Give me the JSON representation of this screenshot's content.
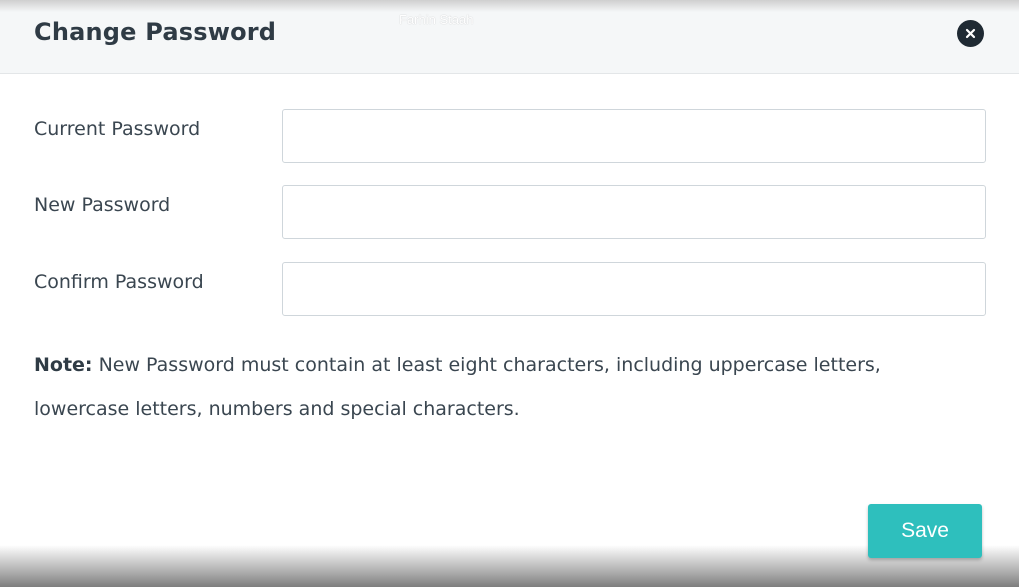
{
  "topbar": {
    "user_name": "Farhin Staah"
  },
  "modal": {
    "title": "Change Password",
    "close_icon": "close-icon",
    "fields": [
      {
        "label": "Current Password",
        "value": "",
        "placeholder": ""
      },
      {
        "label": "New Password",
        "value": "",
        "placeholder": ""
      },
      {
        "label": "Confirm Password",
        "value": "",
        "placeholder": ""
      }
    ],
    "note": {
      "prefix": "Note:",
      "text": " New Password must contain at least eight characters, including uppercase letters, lowercase letters, numbers and special characters."
    },
    "save_label": "Save"
  },
  "colors": {
    "accent": "#2ebfbd",
    "title": "#2f3b45",
    "text": "#3a4650",
    "close_bg": "#1f2a33"
  }
}
